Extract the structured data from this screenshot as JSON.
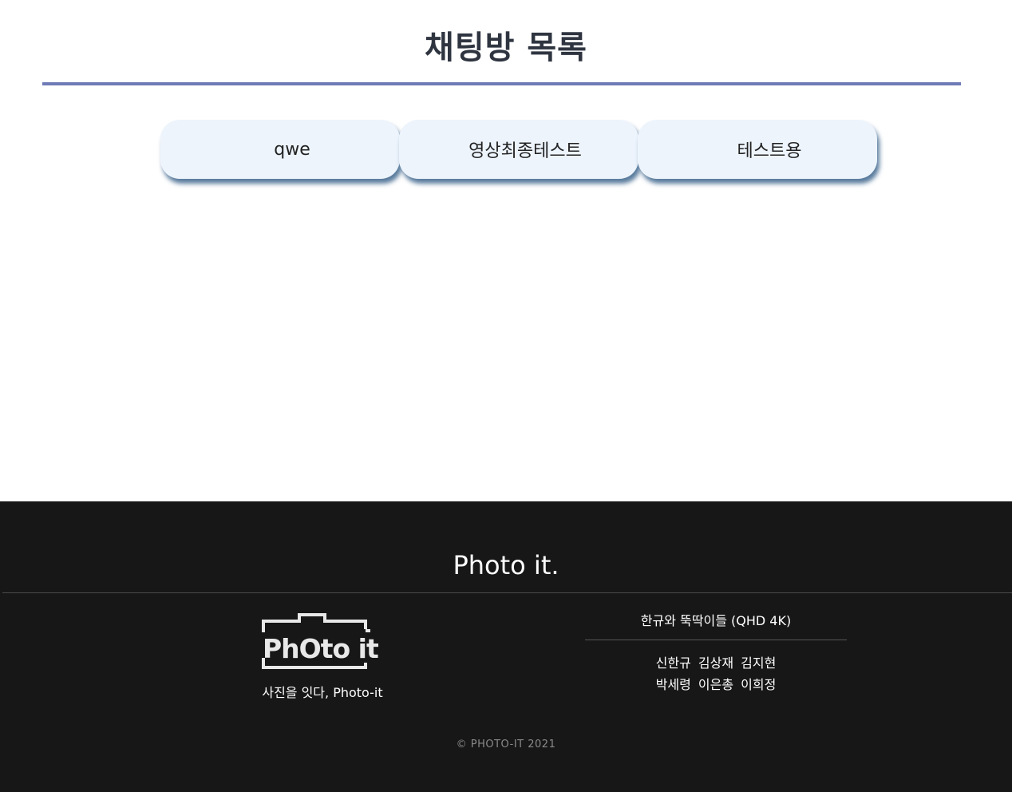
{
  "header": {
    "title": "채팅방 목록",
    "rule_color": "#6f7bb7"
  },
  "rooms": [
    {
      "label": "qwe"
    },
    {
      "label": "영상최종테스트"
    },
    {
      "label": "테스트용"
    }
  ],
  "footer": {
    "brand": "Photo it.",
    "logo_text": "PhOto it",
    "tagline": "사진을 잇다, Photo-it",
    "team_name": "한규와 뚝딱이들 (QHD 4K)",
    "members_row1": "신한규 김상재 김지현",
    "members_row2": "박세령 이은총 이희정",
    "copyright": "© PHOTO-IT 2021",
    "background": "#171717"
  }
}
